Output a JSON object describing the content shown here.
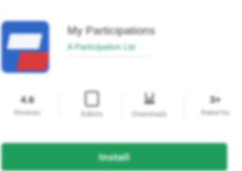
{
  "app": {
    "title": "My Participations",
    "developer": "A Participation Ltd",
    "icon_name": "app-logo-icon"
  },
  "stats": [
    {
      "value": "4.6",
      "label": "Reviews",
      "icon": ""
    },
    {
      "value": "",
      "label": "Editors",
      "icon": "qr-icon"
    },
    {
      "value": "",
      "label": "Downloads",
      "icon": "download-icon"
    },
    {
      "value": "3+",
      "label": "Rated for",
      "icon": ""
    }
  ],
  "install": {
    "label": "Install"
  },
  "colors": {
    "accent": "#1f9e5b",
    "icon_blue": "#2f66c8",
    "icon_red": "#dd3a3c"
  }
}
